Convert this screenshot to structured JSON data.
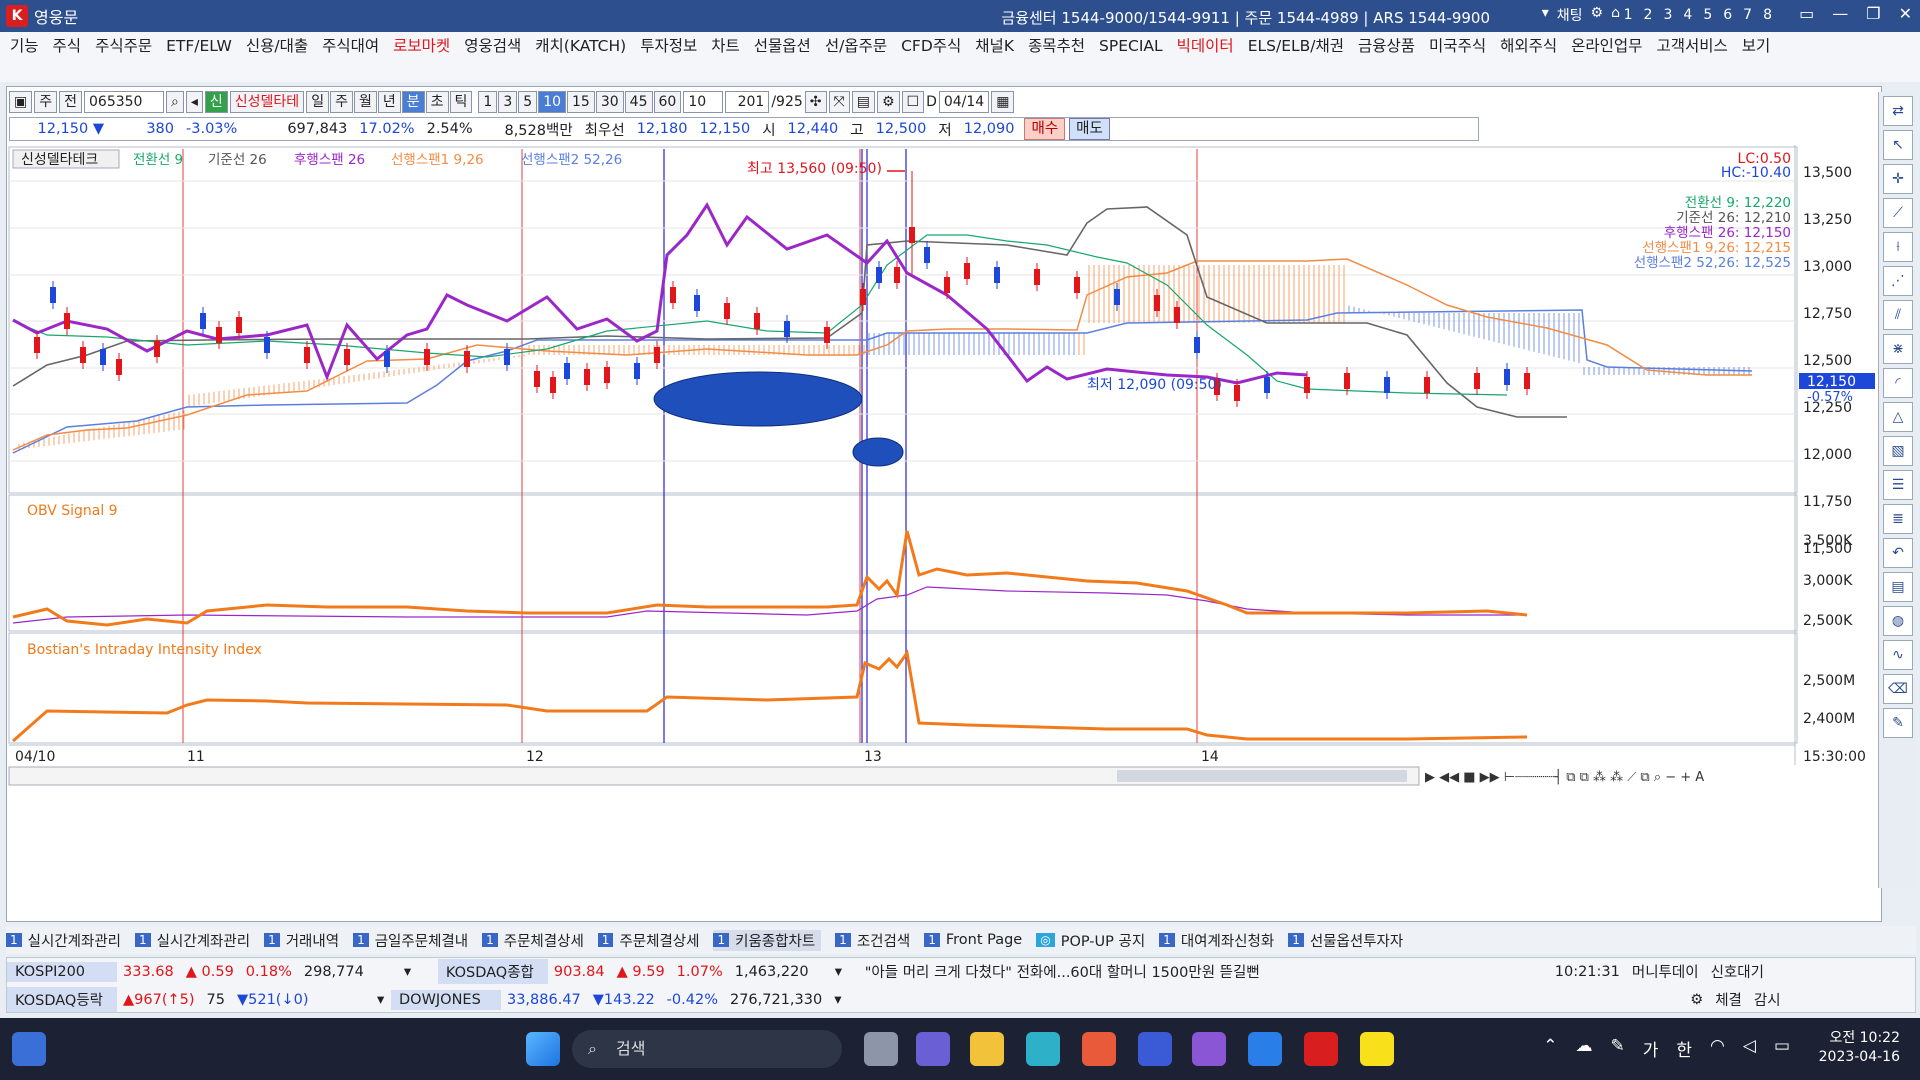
{
  "app": {
    "title": "영웅문",
    "center_info": "금융센터 1544-9000/1544-9911  |  주문 1544-4989  |  ARS 1544-9900",
    "chat": "채팅",
    "page_numbers": [
      "1",
      "2",
      "3",
      "4",
      "5",
      "6",
      "7",
      "8"
    ]
  },
  "menu": [
    "기능",
    "주식",
    "주식주문",
    "ETF/ELW",
    "신용/대출",
    "주식대여",
    "로보마켓",
    "영웅검색",
    "캐치(KATCH)",
    "투자정보",
    "차트",
    "선물옵션",
    "선/옵주문",
    "CFD주식",
    "채널K",
    "종목추천",
    "SPECIAL",
    "빅데이터",
    "ELS/ELB/채권",
    "금융상품",
    "미국주식",
    "해외주식",
    "온라인업무",
    "고객서비스",
    "보기"
  ],
  "menu_red": [
    "로보마켓",
    "빅데이터"
  ],
  "toolbar": {
    "type": "주",
    "jeon": "전",
    "code": "065350",
    "badge": "신",
    "stock_name": "신성델타테",
    "periods": [
      "일",
      "주",
      "월",
      "년",
      "분",
      "초",
      "틱"
    ],
    "selected_period": "분",
    "intervals": [
      "1",
      "3",
      "5",
      "10",
      "15",
      "30",
      "45",
      "60"
    ],
    "selected_interval": "10",
    "interval_value": "10",
    "count": "201",
    "total": "/925",
    "d_label": "D",
    "date": "04/14"
  },
  "quote": {
    "price": "12,150 ▼",
    "change": "380",
    "change_pct": "-3.03%",
    "volume": "697,843",
    "vol_ratio": "17.02%",
    "turnover": "2.54%",
    "amount": "8,528백만",
    "pref_label": "최우선",
    "ask": "12,180",
    "bid": "12,150",
    "open_label": "시",
    "open": "12,440",
    "high_label": "고",
    "high": "12,500",
    "low_label": "저",
    "low": "12,090",
    "buy": "매수",
    "sell": "매도"
  },
  "panel1": {
    "name": "신성델타테크",
    "legend": [
      {
        "label": "전환선 9",
        "color": "#18a86a"
      },
      {
        "label": "기준선 26",
        "color": "#555555"
      },
      {
        "label": "후행스팬 26",
        "color": "#9b27c9"
      },
      {
        "label": "선행스팬1 9,26",
        "color": "#f28c45"
      },
      {
        "label": "선행스팬2 52,26",
        "color": "#5b7fe0"
      }
    ],
    "values_box": [
      {
        "label": "전환선 9: 12,220",
        "color": "#18a86a"
      },
      {
        "label": "기준선 26: 12,210",
        "color": "#555555"
      },
      {
        "label": "후행스팬 26: 12,150",
        "color": "#9b27c9"
      },
      {
        "label": "선행스팬1 9,26: 12,215",
        "color": "#f28c45"
      },
      {
        "label": "선행스팬2 52,26: 12,525",
        "color": "#5b7fe0"
      }
    ],
    "lc": "LC:0.50",
    "hc": "HC:-10.40",
    "high_annotation": "최고 13,560 (09:50)",
    "low_annotation": "최저 12,090 (09:50)",
    "current_price": "12,150",
    "current_pct": "-0.57%",
    "y_ticks": [
      "13,500",
      "13,250",
      "13,000",
      "12,750",
      "12,500",
      "12,250",
      "12,000",
      "11,750",
      "11,500"
    ]
  },
  "panel2": {
    "legend": "OBV  Signal 9",
    "y_ticks": [
      "3,500K",
      "3,000K",
      "2,500K"
    ]
  },
  "panel3": {
    "legend": "Bostian's Intraday Intensity Index",
    "y_ticks": [
      "2,500M",
      "2,400M"
    ]
  },
  "x_axis": {
    "labels": [
      "04/10",
      "11",
      "12",
      "13",
      "14"
    ],
    "time": "15:30:00"
  },
  "bottom_tabs": [
    {
      "num": "1",
      "label": "실시간계좌관리"
    },
    {
      "num": "1",
      "label": "실시간계좌관리"
    },
    {
      "num": "1",
      "label": "거래내역"
    },
    {
      "num": "1",
      "label": "금일주문체결내"
    },
    {
      "num": "1",
      "label": "주문체결상세"
    },
    {
      "num": "1",
      "label": "주문체결상세"
    },
    {
      "num": "1",
      "label": "키움종합차트"
    },
    {
      "num": "1",
      "label": "조건검색"
    },
    {
      "num": "1",
      "label": "Front Page"
    },
    {
      "num": "",
      "label": "POP-UP 공지"
    },
    {
      "num": "1",
      "label": "대여계좌신청화"
    },
    {
      "num": "1",
      "label": "선물옵션투자자"
    }
  ],
  "active_tab": "키움종합차트",
  "ticker": {
    "row1": {
      "label": "KOSPI200",
      "value": "333.68",
      "chg": "▲ 0.59",
      "pct": "0.18%",
      "vol": "298,774",
      "label2": "KOSDAQ종합",
      "value2": "903.84",
      "chg2": "▲ 9.59",
      "pct2": "1.07%",
      "vol2": "1,463,220",
      "news": "\"아들 머리 크게 다쳤다\" 전화에...60대 할머니 1500만원 뜯길뻔",
      "time": "10:21:31",
      "source": "머니투데이",
      "signal": "신호대기"
    },
    "row2": {
      "label": "KOSDAQ등락",
      "up": "▲967(↑5)",
      "flat": "75",
      "down": "▼521(↓0)",
      "label2": "DOWJONES",
      "value2": "33,886.47",
      "chg2": "▼143.22",
      "pct2": "-0.42%",
      "vol2": "276,721,330",
      "fill": "체결",
      "watch": "감시"
    }
  },
  "taskbar": {
    "search": "검색",
    "ampm": "오전 10:22",
    "date": "2023-04-16",
    "ime1": "가",
    "ime2": "한"
  },
  "chart_data": {
    "type": "line",
    "title": "신성델타테크",
    "x": [
      "04/10",
      "11",
      "12",
      "13",
      "14"
    ],
    "price": {
      "high": 13560,
      "low": 12090,
      "last": 12150,
      "ylim": [
        11450,
        13560
      ]
    },
    "series": [
      {
        "name": "전환선 9",
        "last": 12220
      },
      {
        "name": "기준선 26",
        "last": 12210
      },
      {
        "name": "후행스팬 26",
        "last": 12150
      },
      {
        "name": "선행스팬1 9,26",
        "last": 12215
      },
      {
        "name": "선행스팬2 52,26",
        "last": 12525
      }
    ]
  }
}
